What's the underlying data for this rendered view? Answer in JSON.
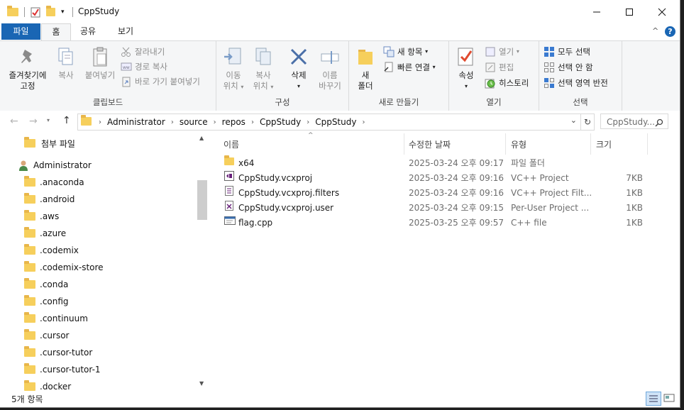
{
  "window": {
    "title": "CppStudy"
  },
  "ribbon_tabs": [
    "파일",
    "홈",
    "공유",
    "보기"
  ],
  "ribbon": {
    "clipboard": {
      "pin_label_1": "즐겨찾기에",
      "pin_label_2": "고정",
      "copy": "복사",
      "paste": "붙여넣기",
      "cut": "잘라내기",
      "copy_path": "경로 복사",
      "paste_shortcut": "바로 가기 붙여넣기",
      "group": "클립보드"
    },
    "organize": {
      "move_1": "이동",
      "move_2": "위치",
      "copy_1": "복사",
      "copy_2": "위치",
      "delete": "삭제",
      "rename_1": "이름",
      "rename_2": "바꾸기",
      "group": "구성"
    },
    "new": {
      "new_folder_1": "새",
      "new_folder_2": "폴더",
      "new_item": "새 항목",
      "easy_access": "빠른 연결",
      "group": "새로 만들기"
    },
    "open": {
      "properties": "속성",
      "open": "열기",
      "edit": "편집",
      "history": "히스토리",
      "group": "열기"
    },
    "select": {
      "select_all": "모두 선택",
      "select_none": "선택 안 함",
      "invert": "선택 영역 반전",
      "group": "선택"
    }
  },
  "address": {
    "crumbs": [
      "Administrator",
      "source",
      "repos",
      "CppStudy",
      "CppStudy"
    ],
    "search_placeholder": "CppStudy..."
  },
  "sidebar": {
    "items": [
      "첨부 파일",
      "Administrator",
      ".anaconda",
      ".android",
      ".aws",
      ".azure",
      ".codemix",
      ".codemix-store",
      ".conda",
      ".config",
      ".continuum",
      ".cursor",
      ".cursor-tutor",
      ".cursor-tutor-1",
      ".docker"
    ]
  },
  "columns": [
    "이름",
    "수정한 날짜",
    "유형",
    "크기"
  ],
  "files": [
    {
      "name": "x64",
      "date": "2025-03-24 오후 09:17",
      "type": "파일 폴더",
      "size": "",
      "icon": "folder-icon"
    },
    {
      "name": "CppStudy.vcxproj",
      "date": "2025-03-24 오후 09:16",
      "type": "VC++ Project",
      "size": "7KB",
      "icon": "vcxproj-icon"
    },
    {
      "name": "CppStudy.vcxproj.filters",
      "date": "2025-03-24 오후 09:16",
      "type": "VC++ Project Filt...",
      "size": "1KB",
      "icon": "filters-icon"
    },
    {
      "name": "CppStudy.vcxproj.user",
      "date": "2025-03-24 오후 09:15",
      "type": "Per-User Project ...",
      "size": "1KB",
      "icon": "user-file-icon"
    },
    {
      "name": "flag.cpp",
      "date": "2025-03-25 오후 09:57",
      "type": "C++ file",
      "size": "1KB",
      "icon": "cpp-file-icon"
    }
  ],
  "status": {
    "count": "5개 항목"
  },
  "colors": {
    "file_tab": "#1a66b4",
    "folder": "#f6cf5c",
    "ribbon_bg": "#f5f6f7"
  }
}
